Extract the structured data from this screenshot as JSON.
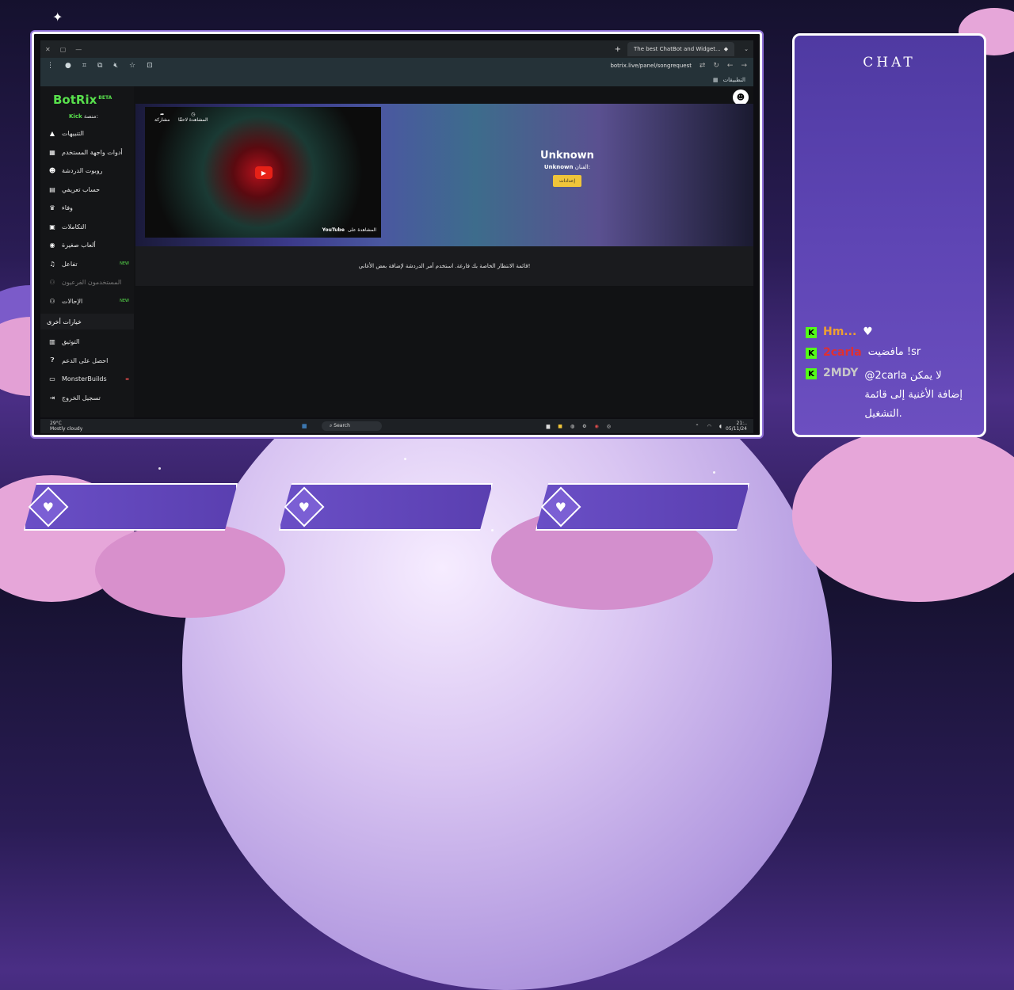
{
  "browser": {
    "tab_title": "The best ChatBot and Widget...",
    "url": "botrix.live/panel/songrequest",
    "bookmarks_label": "التطبيقات"
  },
  "app": {
    "logo": "BotRix",
    "logo_badge": "BETA",
    "platform_label": "منصة:",
    "platform_value": "Kick",
    "menu": [
      {
        "label": "التنبيهات",
        "icon": "warning-icon"
      },
      {
        "label": "أدوات واجهة المستخدم",
        "icon": "grid-icon"
      },
      {
        "label": "روبوت الدردشة",
        "icon": "robot-icon"
      },
      {
        "label": "حساب تعريفي",
        "icon": "id-card-icon"
      },
      {
        "label": "وفاء",
        "icon": "trophy-icon"
      },
      {
        "label": "التكاملات",
        "icon": "plug-icon"
      },
      {
        "label": "ألعاب صغيرة",
        "icon": "gamepad-icon"
      },
      {
        "label": "تفاعل",
        "icon": "music-icon",
        "tag": "NEW"
      },
      {
        "label": "المستخدمون الفرعيون",
        "icon": "users-icon",
        "dim": true
      },
      {
        "label": "الإحالات",
        "icon": "users-icon",
        "tag": "NEW"
      }
    ],
    "section_other": "خيارات أخرى",
    "menu2": [
      {
        "label": "التوثيق",
        "icon": "book-icon"
      },
      {
        "label": "احصل على الدعم",
        "icon": "help-icon"
      },
      {
        "label": "MonsterBuilds",
        "icon": "laptop-icon",
        "tag": "red"
      },
      {
        "label": "تسجيل الخروج",
        "icon": "logout-icon"
      }
    ],
    "video": {
      "share": "مشاركة",
      "watch_later": "المشاهدة لاحقًا",
      "watch_on": "المشاهدة على",
      "youtube": "YouTube"
    },
    "song": {
      "title": "Unknown",
      "artist_label": "الفنان:",
      "artist": "Unknown",
      "settings_button": "إعدادات"
    },
    "queue_empty": "قائمة الانتظار الخاصة بك فارغة. استخدم أمر الدردشة لإضافة بعض الأغاني!"
  },
  "taskbar": {
    "weather_temp": "29°C",
    "weather_desc": "Mostly cloudy",
    "search": "Search",
    "time": "21:..",
    "date": "05/11/24"
  },
  "chat": {
    "title": "CHAT",
    "messages": [
      {
        "user": "Hm...",
        "user_color": "#f0a030",
        "text": ""
      },
      {
        "user": "2carla",
        "user_color": "#e03030",
        "text": "مافضيت !sr"
      },
      {
        "user": "2MDY",
        "user_color": "#c8c8c8",
        "text": "@2carla لا يمكن إضافة الأغنية إلى قائمة التشغيل."
      }
    ]
  },
  "colors": {
    "kick_green": "#53fc18",
    "accent_purple": "#6a4fc6"
  }
}
